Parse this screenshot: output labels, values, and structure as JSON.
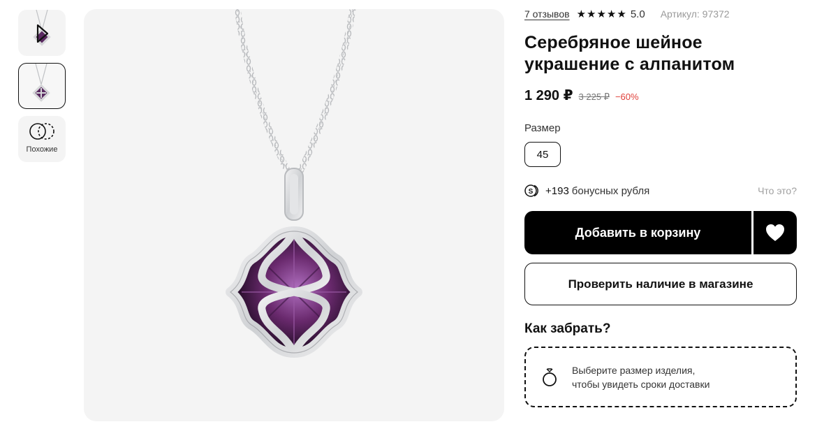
{
  "thumbnails": {
    "similar_label": "Похожие"
  },
  "product": {
    "reviews": "7 отзывов",
    "stars": [
      "★",
      "★",
      "★",
      "★",
      "★"
    ],
    "rating": "5.0",
    "article": "Артикул: 97372",
    "title": "Серебряное шейное украшение с алпанитом",
    "price": "1 290 ₽",
    "old_price": "3 225 ₽",
    "discount": "−60%",
    "size_label": "Размер",
    "size_value": "45",
    "bonus_amount": "+193",
    "bonus_text": "бонусных рубля",
    "bonus_help": "Что это?",
    "add_to_cart": "Добавить в корзину",
    "check_store": "Проверить наличие в магазине",
    "pickup_title": "Как забрать?",
    "delivery_line1": "Выберите размер изделия,",
    "delivery_line2": "чтобы увидеть сроки доставки"
  },
  "colors": {
    "accent": "#000000",
    "discount": "#e0403a",
    "gem": "#6a2a6e",
    "silver": "#d9dadc",
    "gallery_bg": "#f4f4f4"
  },
  "icons": [
    "play-icon",
    "similar-icon",
    "bonus-coin-icon",
    "heart-icon",
    "ring-icon",
    "star-icon"
  ]
}
